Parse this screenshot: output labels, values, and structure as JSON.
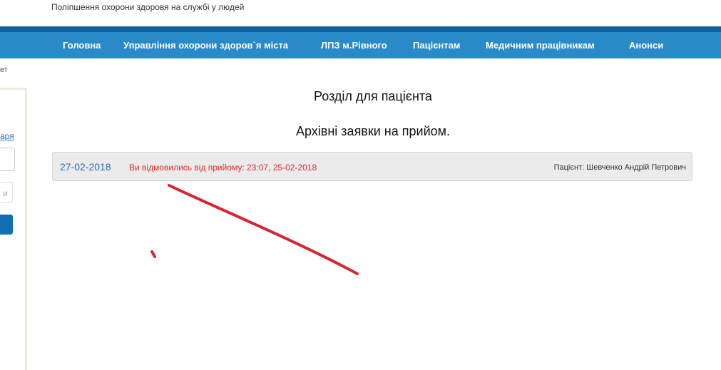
{
  "header": {
    "tagline": "Поліпшення охорони здоровя на службі у людей"
  },
  "nav": {
    "items": [
      "Головна",
      "Управління охорони здоров`я міста",
      "ЛПЗ м.Рівного",
      "Пацієнтам",
      "Медичним працівникам",
      "Анонси"
    ]
  },
  "breadcrumb": {
    "fragment": "ет"
  },
  "sidebar": {
    "link_fragment": "аря",
    "input_fragment": "и"
  },
  "main": {
    "section_title": "Розділ для пацієнта",
    "archive_title": "Архівні заявки на прийом.",
    "appointments": [
      {
        "date": "27-02-2018",
        "status": "Ви відмовились від прийому: 23:07, 25-02-2018",
        "patient": "Пацієнт: Шевченко Андрій Петрович"
      }
    ]
  },
  "colors": {
    "nav_background": "#2a89c7",
    "nav_topline": "#0e62a3",
    "status_text": "#e12b2b",
    "date_text": "#2a6fb3",
    "annotation_stroke": "#d7252f"
  }
}
